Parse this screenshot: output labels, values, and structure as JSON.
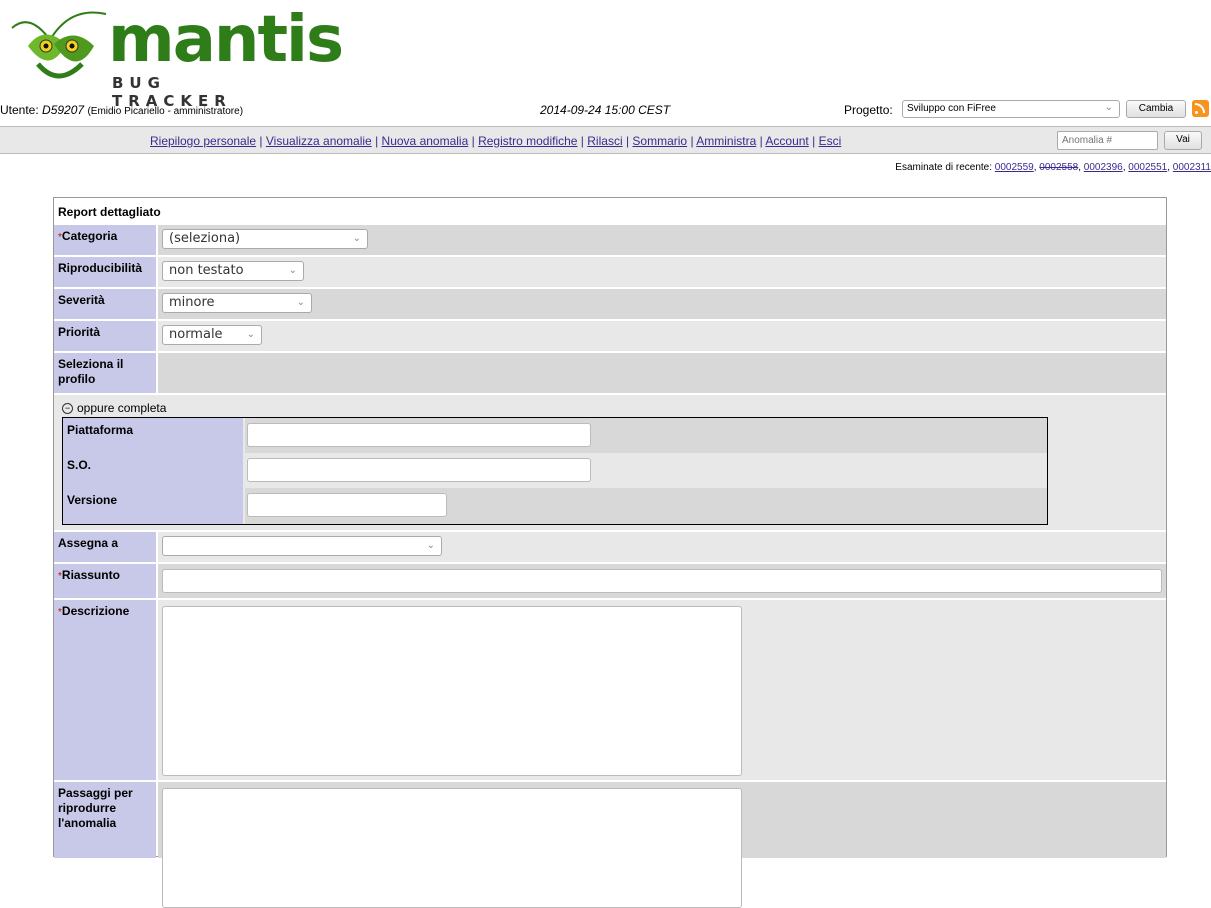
{
  "logo": {
    "word": "mantis",
    "sub": "BUG TRACKER"
  },
  "header": {
    "user_label": "Utente:",
    "user_id": "D59207",
    "user_name": "(Emidio Picariello - amministratore)",
    "datetime": "2014-09-24 15:00 CEST",
    "project_label": "Progetto:",
    "project_value": "Sviluppo con FiFree",
    "change_button": "Cambia"
  },
  "menu": {
    "items": [
      "Riepilogo personale",
      "Visualizza anomalie",
      "Nuova anomalia",
      "Registro modifiche",
      "Rilasci",
      "Sommario",
      "Amministra",
      "Account",
      "Esci"
    ],
    "bug_placeholder": "Anomalia #",
    "go_button": "Vai"
  },
  "recent": {
    "label": "Esaminate di recente:",
    "items": [
      "0002559",
      "0002558",
      "0002396",
      "0002551",
      "0002311"
    ]
  },
  "form": {
    "title": "Report dettagliato",
    "required_mark": "*",
    "category": {
      "label": "Categoria",
      "value": "(seleziona)"
    },
    "reproducibility": {
      "label": "Riproducibilità",
      "value": "non testato"
    },
    "severity": {
      "label": "Severità",
      "value": "minore"
    },
    "priority": {
      "label": "Priorità",
      "value": "normale"
    },
    "profile": {
      "label": "Seleziona il profilo"
    },
    "or_complete": "oppure completa",
    "platform": {
      "label": "Piattaforma",
      "value": ""
    },
    "os": {
      "label": "S.O.",
      "value": ""
    },
    "version": {
      "label": "Versione",
      "value": ""
    },
    "assign": {
      "label": "Assegna a",
      "value": ""
    },
    "summary": {
      "label": "Riassunto",
      "value": ""
    },
    "description": {
      "label": "Descrizione",
      "value": ""
    },
    "steps": {
      "label": "Passaggi per riprodurre l'anomalia",
      "value": ""
    }
  }
}
